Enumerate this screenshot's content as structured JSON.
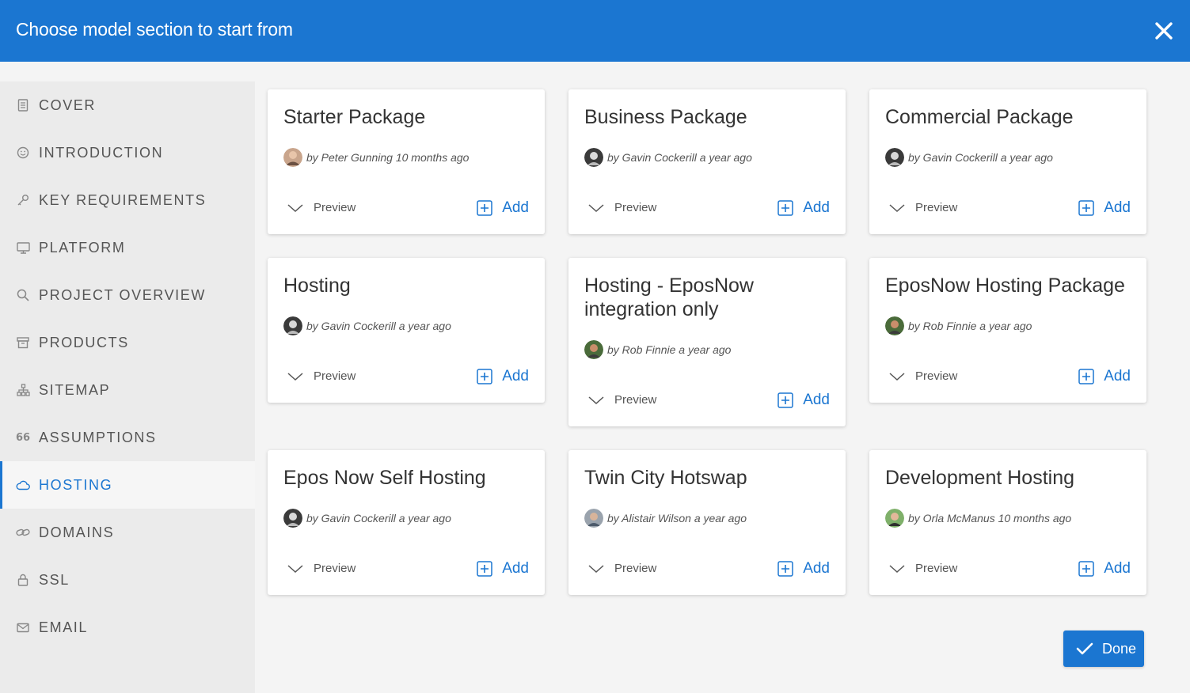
{
  "header": {
    "title": "Choose model section to start from"
  },
  "sidebar": {
    "items": [
      {
        "label": "COVER",
        "icon": "document-icon",
        "active": false
      },
      {
        "label": "INTRODUCTION",
        "icon": "smiley-icon",
        "active": false
      },
      {
        "label": "KEY REQUIREMENTS",
        "icon": "key-icon",
        "active": false
      },
      {
        "label": "PLATFORM",
        "icon": "monitor-icon",
        "active": false
      },
      {
        "label": "PROJECT OVERVIEW",
        "icon": "search-icon",
        "active": false
      },
      {
        "label": "PRODUCTS",
        "icon": "box-icon",
        "active": false
      },
      {
        "label": "SITEMAP",
        "icon": "sitemap-icon",
        "active": false
      },
      {
        "label": "ASSUMPTIONS",
        "icon": "quote-icon",
        "active": false
      },
      {
        "label": "HOSTING",
        "icon": "cloud-icon",
        "active": true
      },
      {
        "label": "DOMAINS",
        "icon": "link-icon",
        "active": false
      },
      {
        "label": "SSL",
        "icon": "lock-icon",
        "active": false
      },
      {
        "label": "EMAIL",
        "icon": "envelope-icon",
        "active": false
      }
    ]
  },
  "cards": [
    {
      "title": "Starter Package",
      "author": "by Peter Gunning 10 months ago",
      "preview_label": "Preview",
      "add_label": "Add"
    },
    {
      "title": "Business Package",
      "author": "by Gavin Cockerill a year ago",
      "preview_label": "Preview",
      "add_label": "Add"
    },
    {
      "title": "Commercial Package",
      "author": "by Gavin Cockerill a year ago",
      "preview_label": "Preview",
      "add_label": "Add"
    },
    {
      "title": "Hosting",
      "author": "by Gavin Cockerill a year ago",
      "preview_label": "Preview",
      "add_label": "Add"
    },
    {
      "title": "Hosting - EposNow integration only",
      "author": "by Rob Finnie a year ago",
      "preview_label": "Preview",
      "add_label": "Add"
    },
    {
      "title": "EposNow Hosting Package",
      "author": "by Rob Finnie a year ago",
      "preview_label": "Preview",
      "add_label": "Add"
    },
    {
      "title": "Epos Now Self Hosting",
      "author": "by Gavin Cockerill a year ago",
      "preview_label": "Preview",
      "add_label": "Add"
    },
    {
      "title": "Twin City Hotswap",
      "author": "by Alistair Wilson a year ago",
      "preview_label": "Preview",
      "add_label": "Add"
    },
    {
      "title": "Development Hosting",
      "author": "by Orla McManus 10 months ago",
      "preview_label": "Preview",
      "add_label": "Add"
    }
  ],
  "footer": {
    "done_label": "Done"
  },
  "colors": {
    "accent": "#1b76d1",
    "sidebar_bg": "#ebebeb",
    "page_bg": "#f4f4f4"
  }
}
